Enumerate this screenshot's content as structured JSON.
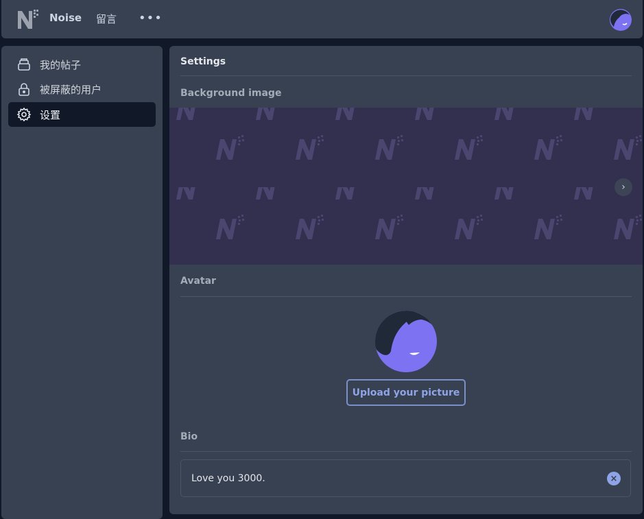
{
  "header": {
    "logo_icon": "noise-logo-icon",
    "nav": [
      {
        "label": "Noise"
      },
      {
        "label": "留言"
      }
    ],
    "more_label": "•••",
    "avatar_icon": "user-avatar-icon"
  },
  "sidebar": {
    "items": [
      {
        "label": "我的帖子",
        "icon": "stack-icon",
        "active": false
      },
      {
        "label": "被屏蔽的用户",
        "icon": "lock-icon",
        "active": false
      },
      {
        "label": "设置",
        "icon": "gear-icon",
        "active": true
      }
    ]
  },
  "settings": {
    "title": "Settings",
    "background": {
      "label": "Background image",
      "next_icon": "chevron-right-icon"
    },
    "avatar": {
      "label": "Avatar",
      "upload_label": "Upload your picture"
    },
    "bio": {
      "label": "Bio",
      "value": "Love you 3000.",
      "clear_icon": "clear-icon"
    }
  },
  "colors": {
    "background": "#111827",
    "panel": "#374151",
    "accent": "#8ea4e6",
    "avatar": "#7c72f2",
    "pattern_bg": "#322f4f"
  }
}
